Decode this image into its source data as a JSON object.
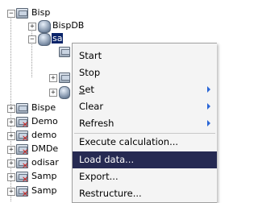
{
  "tree": {
    "root": {
      "label": "Bisp",
      "expander": "−"
    },
    "child_db": {
      "label": "BispDB",
      "expander": "+"
    },
    "selected_db": {
      "label": "sa",
      "expander": "−"
    },
    "other_items": [
      {
        "label": "Bispe",
        "expander": "+"
      },
      {
        "label": "Demo",
        "expander": "+"
      },
      {
        "label": "demo",
        "expander": "+"
      },
      {
        "label": "DMDe",
        "expander": "+"
      },
      {
        "label": "odisar",
        "expander": "+"
      },
      {
        "label": "Samp",
        "expander": "+"
      },
      {
        "label": "Samp",
        "expander": "+"
      }
    ],
    "nested_expanders": [
      "+",
      "+"
    ]
  },
  "context_menu": {
    "items": [
      {
        "label": "Start",
        "submenu": false,
        "highlighted": false
      },
      {
        "label": "Stop",
        "submenu": false,
        "highlighted": false
      },
      {
        "label": "Set",
        "underline": "S",
        "rest": "et",
        "submenu": true,
        "highlighted": false
      },
      {
        "label": "Clear",
        "submenu": true,
        "highlighted": false
      },
      {
        "label": "Refresh",
        "submenu": true,
        "highlighted": false
      },
      {
        "label": "Execute calculation...",
        "submenu": false,
        "highlighted": false
      },
      {
        "label": "Load data...",
        "submenu": false,
        "highlighted": true
      },
      {
        "label": "Export...",
        "submenu": false,
        "highlighted": false
      },
      {
        "label": "Restructure...",
        "submenu": false,
        "highlighted": false
      }
    ]
  },
  "colors": {
    "highlight": "#262a52",
    "submenu_arrow": "#2a66d6",
    "error_x": "#c8201e"
  },
  "icons": {
    "server": "server-icon",
    "database": "database-icon",
    "error": "red-x-icon"
  }
}
